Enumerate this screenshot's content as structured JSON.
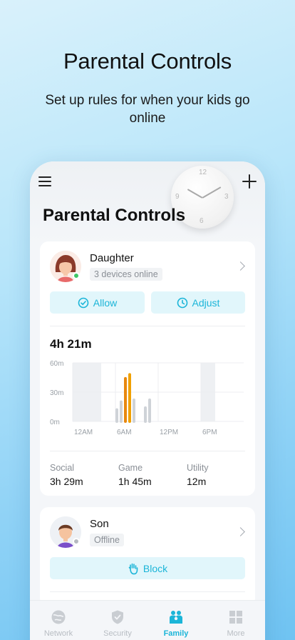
{
  "hero": {
    "title": "Parental Controls",
    "subtitle": "Set up rules for when your kids go online"
  },
  "app": {
    "page_title": "Parental Controls",
    "clock_numbers": [
      "12",
      "3",
      "6",
      "9"
    ]
  },
  "members": [
    {
      "name": "Daughter",
      "badge": "3 devices online",
      "status": "online",
      "status_color": "#3fc766",
      "actions": [
        "Allow",
        "Adjust"
      ],
      "total_time": "4h 21m",
      "stats": [
        {
          "label": "Social",
          "value": "3h 29m"
        },
        {
          "label": "Game",
          "value": "1h 45m"
        },
        {
          "label": "Utility",
          "value": "12m"
        }
      ]
    },
    {
      "name": "Son",
      "badge": "Offline",
      "status": "offline",
      "status_color": "#b6bac0",
      "actions": [
        "Block"
      ]
    }
  ],
  "chart_data": {
    "type": "bar",
    "y_ticks": [
      "60m",
      "30m",
      "0m"
    ],
    "x_ticks": [
      "12AM",
      "6AM",
      "12PM",
      "6PM"
    ],
    "ylim": [
      0,
      60
    ],
    "blocked_periods": [
      [
        0,
        2
      ],
      [
        9,
        10
      ]
    ],
    "bars": [
      {
        "hour": 3.1,
        "value": 12,
        "color": "#cfd3d8"
      },
      {
        "hour": 3.4,
        "value": 20,
        "color": "#cfd3d8"
      },
      {
        "hour": 3.7,
        "value": 44,
        "color": "#e8880f"
      },
      {
        "hour": 4.0,
        "value": 48,
        "color": "#f0a000"
      },
      {
        "hour": 4.3,
        "value": 22,
        "color": "#cfd3d8"
      },
      {
        "hour": 5.1,
        "value": 14,
        "color": "#cfd3d8"
      },
      {
        "hour": 5.4,
        "value": 22,
        "color": "#cfd3d8"
      }
    ]
  },
  "tabs": [
    {
      "label": "Network",
      "icon": "globe-icon",
      "active": false
    },
    {
      "label": "Security",
      "icon": "shield-icon",
      "active": false
    },
    {
      "label": "Family",
      "icon": "family-icon",
      "active": true
    },
    {
      "label": "More",
      "icon": "grid-icon",
      "active": false
    }
  ],
  "colors": {
    "accent": "#1bb5d8",
    "pill_bg": "#e1f6fb"
  }
}
